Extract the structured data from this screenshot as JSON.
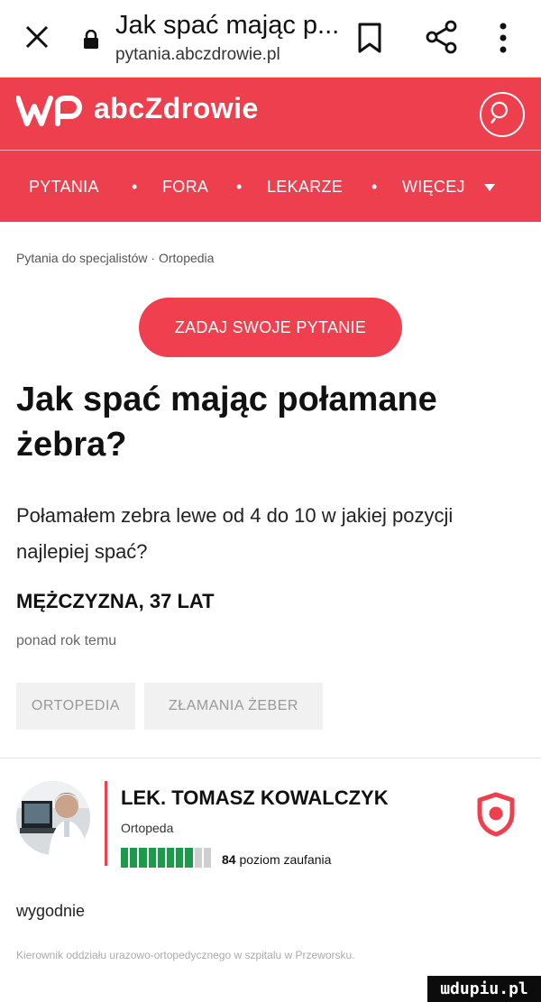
{
  "browser": {
    "tab_title": "Jak spać mając p...",
    "url": "pytania.abczdrowie.pl"
  },
  "site": {
    "logo_text": "abcZdrowie",
    "brand_color": "#ee3f4e"
  },
  "nav": {
    "items": [
      "PYTANIA",
      "FORA",
      "LEKARZE",
      "WIĘCEJ"
    ],
    "separator": "•",
    "more_icon": "caret-down-icon"
  },
  "breadcrumb": {
    "text": "Pytania do specjalistów · Ortopedia"
  },
  "ask_button": "ZADAJ SWOJE PYTANIE",
  "question": {
    "title": "Jak spać mając połamane żebra?",
    "body": "Połamałem zebra lewe od 4 do 10 w jakiej pozycji najlepiej spać?",
    "author": "MĘŻCZYZNA, 37 LAT",
    "time": "ponad rok temu",
    "tags": [
      "ORTOPEDIA",
      "ZŁAMANIA ŻEBER"
    ]
  },
  "answer": {
    "doctor_name": "LEK. TOMASZ KOWALCZYK",
    "specialty": "Ortopeda",
    "trust_value": "84",
    "trust_label": "poziom zaufania",
    "trust_level_fraction": 0.84,
    "text": "wygodnie",
    "footer": "Kierownik oddziału urazowo-ortopedycznego w szpitalu w Przeworsku."
  },
  "watermark": "ɯdupiu.pl"
}
